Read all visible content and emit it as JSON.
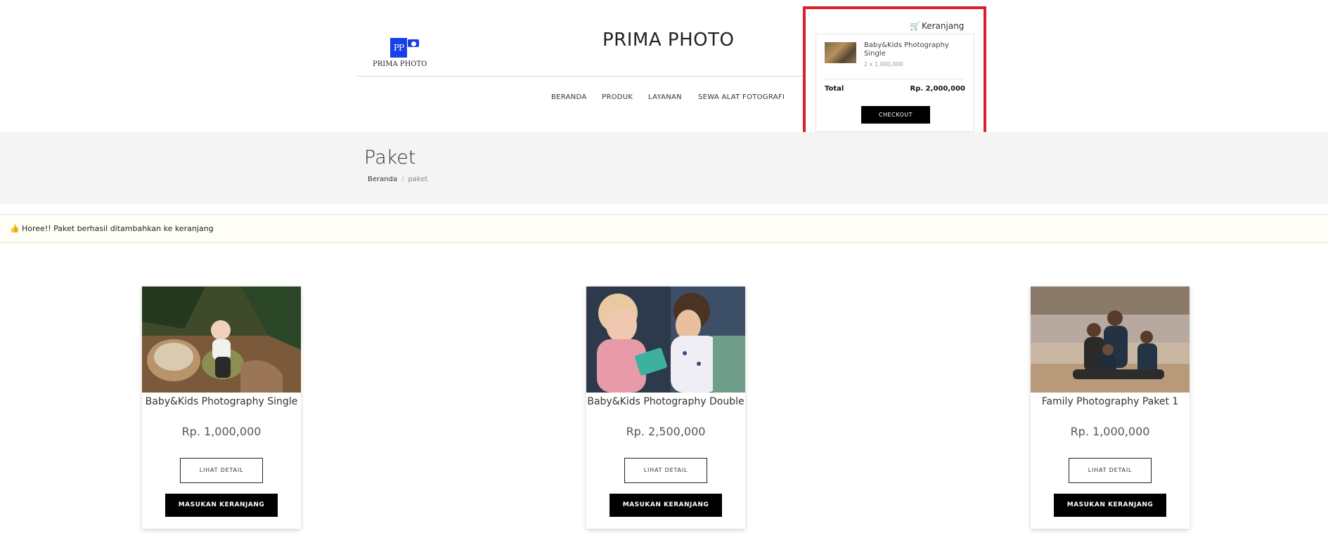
{
  "brand": {
    "logo_text": "PRIMA PHOTO",
    "logo_mark": "PP",
    "site_title": "PRIMA PHOTO",
    "logo_color": "#1740e6"
  },
  "nav": {
    "items": [
      {
        "label": "BERANDA"
      },
      {
        "label": "PRODUK"
      },
      {
        "label": "LAYANAN"
      },
      {
        "label": "SEWA ALAT FOTOGRAFI"
      }
    ]
  },
  "cart": {
    "link_label": "Keranjang",
    "icon": "cart-icon",
    "items": [
      {
        "name": "Baby&Kids Photography Single",
        "qty_line": "2 x 1,000,000"
      }
    ],
    "total_label": "Total",
    "total_value": "Rp. 2,000,000",
    "checkout_label": "CHECKOUT",
    "highlight_color": "#dd1f2b"
  },
  "page": {
    "title": "Paket",
    "breadcrumb": [
      {
        "label": "Beranda"
      },
      {
        "label": "paket"
      }
    ]
  },
  "alert": {
    "icon": "thumbs-up-icon",
    "text": "Horee!! Paket berhasil ditambahkan ke keranjang"
  },
  "products": [
    {
      "name": "Baby&Kids Photography Single",
      "price": "Rp. 1,000,000",
      "detail_label": "LIHAT DETAIL",
      "cart_label": "MASUKAN KERANJANG"
    },
    {
      "name": "Baby&Kids Photography Double",
      "price": "Rp. 2,500,000",
      "detail_label": "LIHAT DETAIL",
      "cart_label": "MASUKAN KERANJANG"
    },
    {
      "name": "Family Photography Paket 1",
      "price": "Rp. 1,000,000",
      "detail_label": "LIHAT DETAIL",
      "cart_label": "MASUKAN KERANJANG"
    }
  ]
}
